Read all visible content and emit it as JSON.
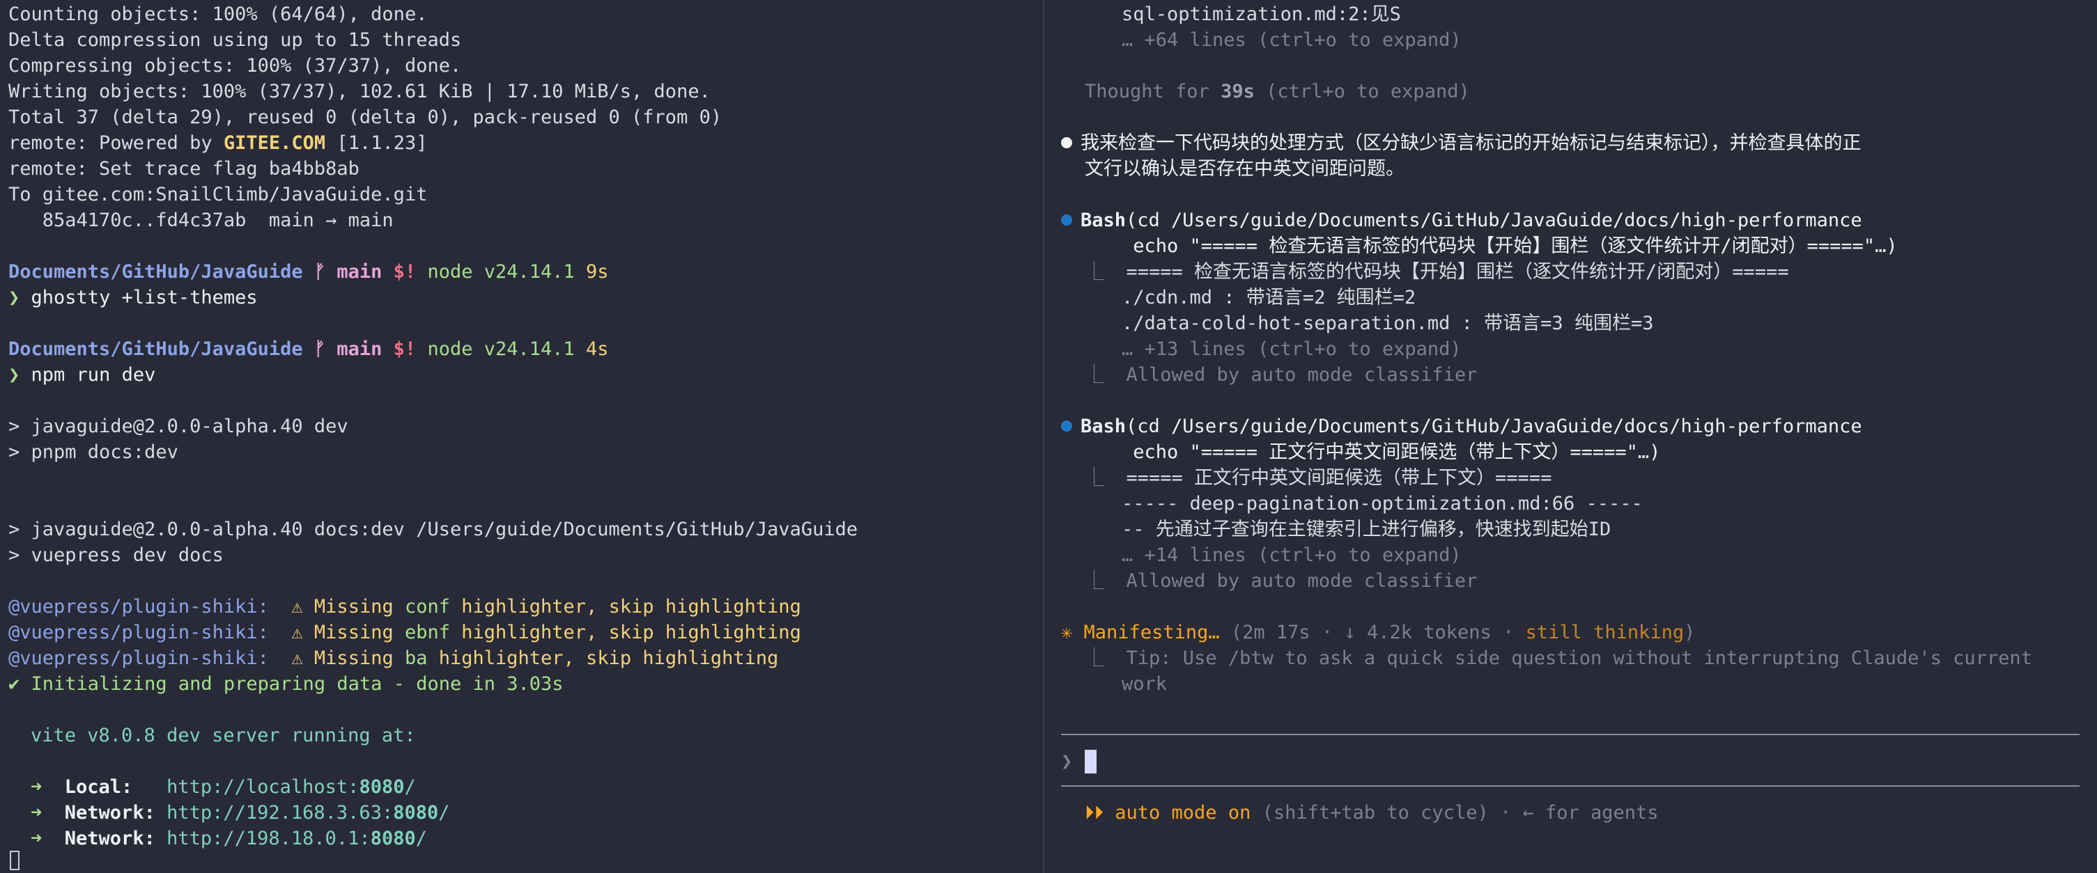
{
  "left": {
    "git": [
      "Counting objects: 100% (64/64), done.",
      "Delta compression using up to 15 threads",
      "Compressing objects: 100% (37/37), done.",
      "Writing objects: 100% (37/37), 102.61 KiB | 17.10 MiB/s, done.",
      "Total 37 (delta 29), reused 0 (delta 0), pack-reused 0 (from 0)"
    ],
    "remote_powered_prefix": "remote: Powered by ",
    "remote_powered_brand": "GITEE.COM",
    "remote_powered_suffix": " [1.1.23]",
    "remote_trace": "remote: Set trace flag ba4bb8ab",
    "push_to": "To gitee.com:SnailClimb/JavaGuide.git",
    "push_ref": "   85a4170c..fd4c37ab  main → main",
    "prompt1": {
      "path": "Documents/GitHub/JavaGuide",
      "branch_icon": "ᚠ",
      "branch": "main",
      "status": "$!",
      "node": "node v24.14.1",
      "time": "9s",
      "arrow": "❯",
      "command": "ghostty +list-themes"
    },
    "prompt2": {
      "path": "Documents/GitHub/JavaGuide",
      "branch_icon": "ᚠ",
      "branch": "main",
      "status": "$!",
      "node": "node v24.14.1",
      "time": "4s",
      "arrow": "❯",
      "command": "npm run dev"
    },
    "npm1": "> javaguide@2.0.0-alpha.40 dev",
    "npm2": "> pnpm docs:dev",
    "npm3": "> javaguide@2.0.0-alpha.40 docs:dev /Users/guide/Documents/GitHub/JavaGuide",
    "npm4": "> vuepress dev docs",
    "warnings": [
      {
        "plugin": "@vuepress/plugin-shiki:",
        "icon": "⚠",
        "pre": "Missing ",
        "lang": "conf",
        "post": " highlighter, skip highlighting"
      },
      {
        "plugin": "@vuepress/plugin-shiki:",
        "icon": "⚠",
        "pre": "Missing ",
        "lang": "ebnf",
        "post": " highlighter, skip highlighting"
      },
      {
        "plugin": "@vuepress/plugin-shiki:",
        "icon": "⚠",
        "pre": "Missing ",
        "lang": "ba",
        "post": " highlighter, skip highlighting"
      }
    ],
    "init": "✔ Initializing and preparing data - done in 3.03s",
    "vite": "vite v8.0.8 dev server running at:",
    "servers": [
      {
        "arrow": "➜",
        "label": "Local:  ",
        "url": "http://localhost:",
        "port": "8080",
        "slash": "/"
      },
      {
        "arrow": "➜",
        "label": "Network:",
        "url": "http://192.168.3.63:",
        "port": "8080",
        "slash": "/"
      },
      {
        "arrow": "➜",
        "label": "Network:",
        "url": "http://198.18.0.1:",
        "port": "8080",
        "slash": "/"
      }
    ]
  },
  "right": {
    "top1": "sql-optimization.md:2:见S",
    "top2": "… +64 lines (ctrl+o to expand)",
    "thought_pre": "Thought for ",
    "thought_time": "39s",
    "thought_post": " (ctrl+o to expand)",
    "msg1": "我来检查一下代码块的处理方式（区分缺少语言标记的开始标记与结束标记），并检查具体的正",
    "msg2": "文行以确认是否存在中英文间距问题。",
    "bash1": {
      "name": "Bash",
      "cmd": "(cd /Users/guide/Documents/GitHub/JavaGuide/docs/high-performance",
      "cmd2": " echo \"===== 检查无语言标签的代码块【开始】围栏（逐文件统计开/闭配对）=====\"…)",
      "out1": "===== 检查无语言标签的代码块【开始】围栏（逐文件统计开/闭配对）=====",
      "out2": "./cdn.md : 带语言=2 纯围栏=2",
      "out3": "./data-cold-hot-separation.md : 带语言=3 纯围栏=3",
      "more": "… +13 lines (ctrl+o to expand)",
      "allowed": "Allowed by auto mode classifier"
    },
    "bash2": {
      "name": "Bash",
      "cmd": "(cd /Users/guide/Documents/GitHub/JavaGuide/docs/high-performance",
      "cmd2": " echo \"===== 正文行中英文间距候选（带上下文）=====\"…)",
      "out1": "===== 正文行中英文间距候选（带上下文）=====",
      "out2": "----- deep-pagination-optimization.md:66 -----",
      "out3": "-- 先通过子查询在主键索引上进行偏移，快速找到起始ID",
      "more": "… +14 lines (ctrl+o to expand)",
      "allowed": "Allowed by auto mode classifier"
    },
    "status": {
      "icon": "✳",
      "label": "Manifesting…",
      "open": " (",
      "time": "2m 17s",
      "sep1": " · ",
      "tokens": "↓ 4.2k tokens",
      "sep2": " · ",
      "thinking": "still thinking",
      "close": ")"
    },
    "tip1": "Tip: Use /btw to ask a quick side question without interrupting Claude's current",
    "tip2": "work",
    "corner": "⎿",
    "input_prompt": "❯",
    "mode_icon": "⏵⏵",
    "mode_label": "auto mode on",
    "mode_hint": " (shift+tab to cycle) · ← for agents"
  },
  "colors": {
    "background": "#292a37",
    "accent_orange": "#f5a623",
    "path_blue": "#8ba4e8",
    "node_green": "#a7df8f",
    "bash_dot": "#1e78c8"
  }
}
